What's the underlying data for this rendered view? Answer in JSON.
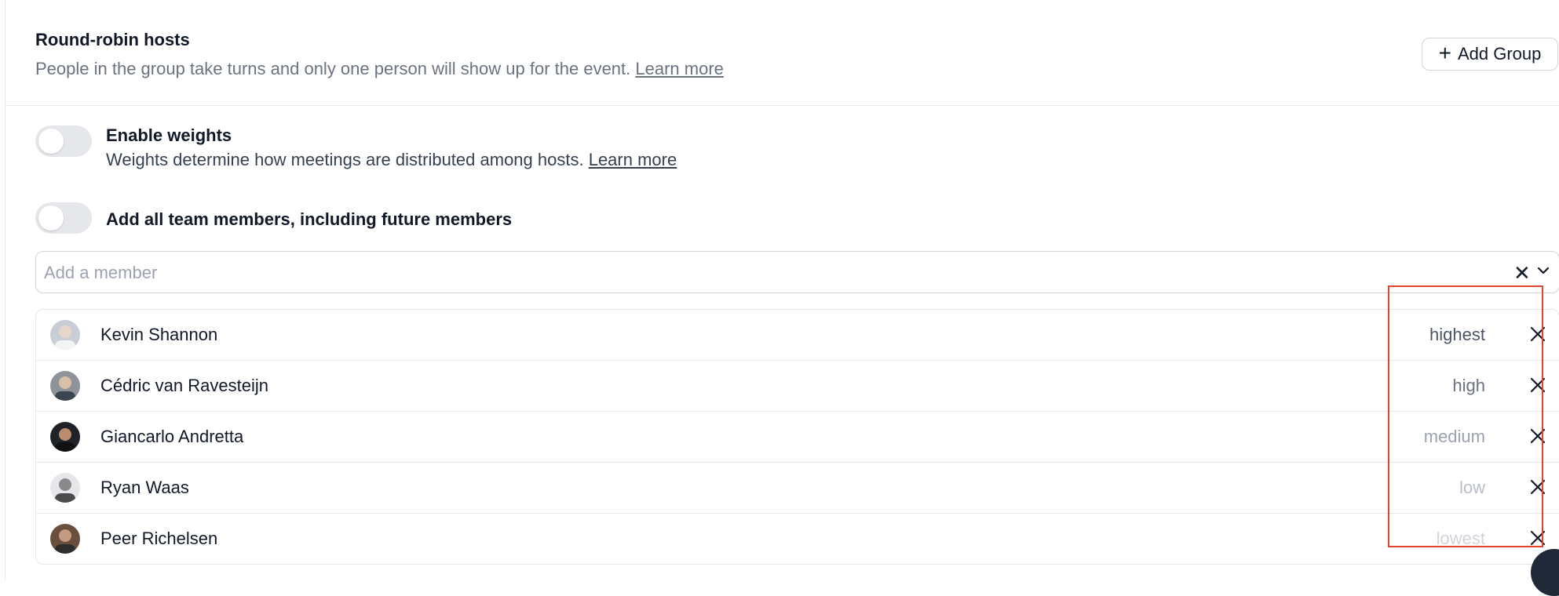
{
  "header": {
    "title": "Round-robin hosts",
    "subtitle": "People in the group take turns and only one person will show up for the event.",
    "learn_more": "Learn more",
    "add_group_icon": "+",
    "add_group_label": "Add Group"
  },
  "weights": {
    "title": "Enable weights",
    "description": "Weights determine how meetings are distributed among hosts.",
    "learn_more": "Learn more",
    "enabled": false
  },
  "all_members": {
    "title": "Add all team members, including future members",
    "enabled": false
  },
  "member_select": {
    "placeholder": "Add a member",
    "clear_icon": "✕",
    "dropdown_icon": "chevron-down-icon"
  },
  "members": [
    {
      "name": "Kevin Shannon",
      "weight": "highest",
      "weight_color": "#4b5563"
    },
    {
      "name": "Cédric van Ravesteijn",
      "weight": "high",
      "weight_color": "#6b7280"
    },
    {
      "name": "Giancarlo Andretta",
      "weight": "medium",
      "weight_color": "#9ca3af"
    },
    {
      "name": "Ryan Waas",
      "weight": "low",
      "weight_color": "#b8bec7"
    },
    {
      "name": "Peer Richelsen",
      "weight": "lowest",
      "weight_color": "#d1d5db"
    }
  ],
  "colors": {
    "highlight_box": "#e0432e",
    "toggle_off": "#e5e7eb"
  }
}
